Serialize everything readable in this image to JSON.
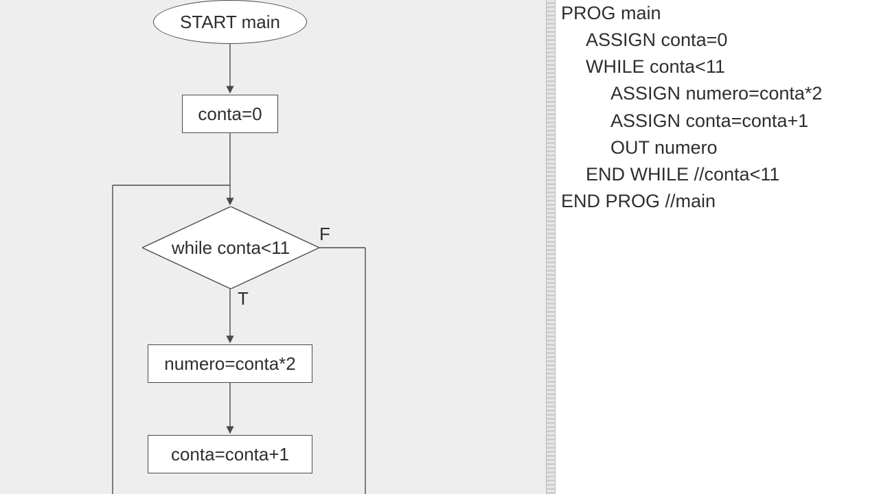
{
  "flowchart": {
    "start": "START main",
    "assign_init": "conta=0",
    "while_cond": "while conta<11",
    "assign_numero": "numero=conta*2",
    "assign_inc": "conta=conta+1",
    "label_true": "T",
    "label_false": "F"
  },
  "code": {
    "l0": "PROG main",
    "l1": "ASSIGN conta=0",
    "l2": "WHILE conta<11",
    "l3": "ASSIGN numero=conta*2",
    "l4": "ASSIGN conta=conta+1",
    "l5": "OUT numero",
    "l6": "END WHILE //conta<11",
    "l7": "END PROG //main"
  }
}
